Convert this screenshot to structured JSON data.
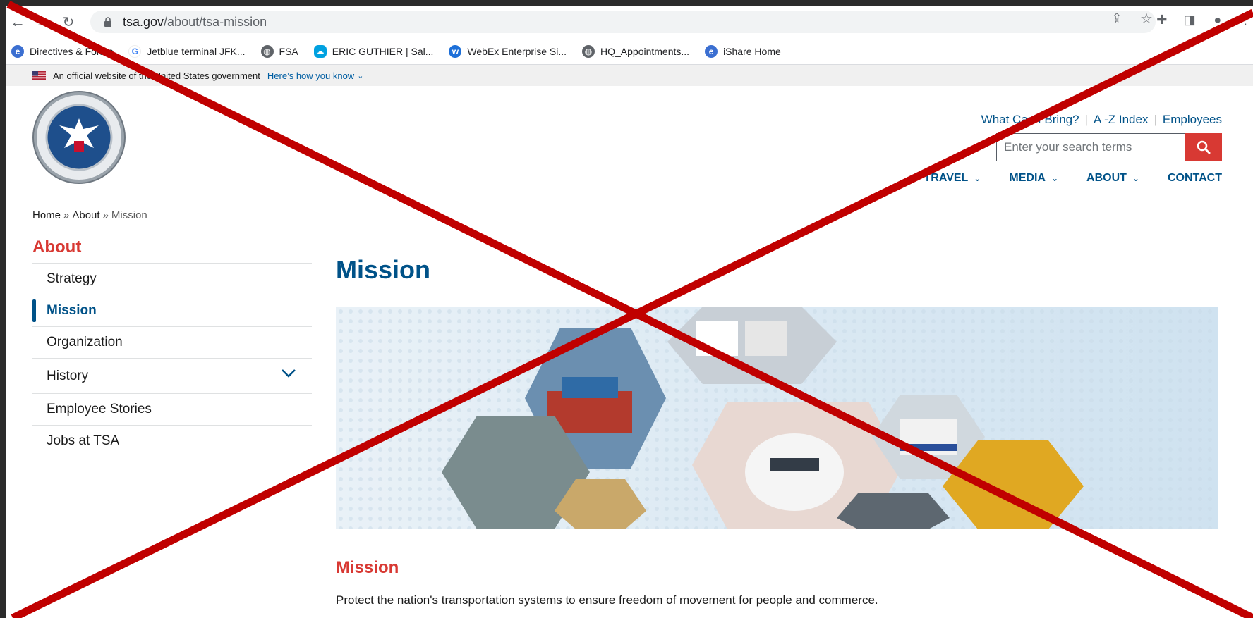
{
  "browser": {
    "url_domain": "tsa.gov",
    "url_path": "/about/tsa-mission",
    "bookmarks": [
      {
        "label": "Directives & Forms",
        "icon": "edge-icon"
      },
      {
        "label": "Jetblue terminal JFK...",
        "icon": "google-icon"
      },
      {
        "label": "FSA",
        "icon": "globe-icon"
      },
      {
        "label": "ERIC GUTHIER | Sal...",
        "icon": "salesforce-icon"
      },
      {
        "label": "WebEx Enterprise Si...",
        "icon": "webex-icon"
      },
      {
        "label": "HQ_Appointments...",
        "icon": "globe-icon"
      },
      {
        "label": "iShare Home",
        "icon": "edge-icon"
      }
    ]
  },
  "gov_banner": {
    "text": "An official website of the United States government",
    "link": "Here’s how you know"
  },
  "header": {
    "util_links": [
      "What Can I Bring?",
      "A -Z Index",
      "Employees"
    ],
    "search_placeholder": "Enter your search terms",
    "nav": [
      {
        "label": "TRAVEL",
        "has_dropdown": true
      },
      {
        "label": "MEDIA",
        "has_dropdown": true
      },
      {
        "label": "ABOUT",
        "has_dropdown": true
      },
      {
        "label": "CONTACT",
        "has_dropdown": false
      }
    ]
  },
  "breadcrumb": {
    "home": "Home",
    "about": "About",
    "current": "Mission",
    "separator": "»"
  },
  "sidebar": {
    "title": "About",
    "items": [
      {
        "label": "Strategy"
      },
      {
        "label": "Mission"
      },
      {
        "label": "Organization"
      },
      {
        "label": "History"
      },
      {
        "label": "Employee Stories"
      },
      {
        "label": "Jobs at TSA"
      }
    ]
  },
  "main": {
    "title": "Mission",
    "section_heading": "Mission",
    "section_text": "Protect the nation's transportation systems to ensure freedom of movement for people and commerce."
  },
  "colors": {
    "tsa_blue": "#005288",
    "tsa_red": "#d83933",
    "overlay_x": "#c00000"
  }
}
